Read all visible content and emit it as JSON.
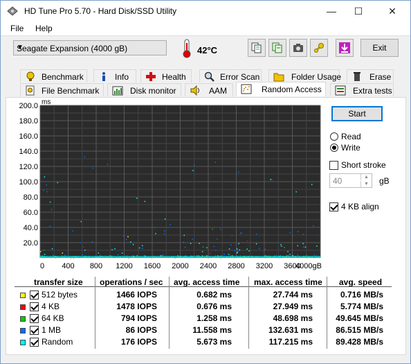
{
  "window": {
    "title": "HD Tune Pro 5.70 - Hard Disk/SSD Utility",
    "minimize": "—",
    "maximize": "☐",
    "close": "✕"
  },
  "menu": {
    "file": "File",
    "help": "Help"
  },
  "toolbar": {
    "drive": "Seagate Expansion (4000 gB)",
    "temperature": "42°C",
    "exit_label": "Exit"
  },
  "tabs_row1": [
    {
      "label": "Benchmark",
      "icon": "benchmark-icon"
    },
    {
      "label": "Info",
      "icon": "info-icon"
    },
    {
      "label": "Health",
      "icon": "health-icon"
    },
    {
      "label": "Error Scan",
      "icon": "error-scan-icon"
    },
    {
      "label": "Folder Usage",
      "icon": "folder-icon"
    },
    {
      "label": "Erase",
      "icon": "erase-icon"
    }
  ],
  "tabs_row2": [
    {
      "label": "File Benchmark",
      "icon": "file-benchmark-icon"
    },
    {
      "label": "Disk monitor",
      "icon": "disk-monitor-icon"
    },
    {
      "label": "AAM",
      "icon": "aam-icon"
    },
    {
      "label": "Random Access",
      "icon": "random-access-icon"
    },
    {
      "label": "Extra tests",
      "icon": "extra-tests-icon"
    }
  ],
  "controls": {
    "start_label": "Start",
    "read_label": "Read",
    "write_label": "Write",
    "mode": "write",
    "short_stroke_label": "Short stroke",
    "short_stroke_checked": false,
    "stroke_value": "40",
    "stroke_unit": "gB",
    "align_label": "4 KB align",
    "align_checked": true
  },
  "chart_data": {
    "type": "scatter",
    "ylabel": "ms",
    "xlabel": "",
    "ylim": [
      0,
      200
    ],
    "xlim": [
      0,
      4000
    ],
    "yticks": [
      "200.0",
      "180.0",
      "160.0",
      "140.0",
      "120.0",
      "100.0",
      "80.0",
      "60.0",
      "40.0",
      "20.0"
    ],
    "xticks": [
      "0",
      "400",
      "800",
      "1200",
      "1600",
      "2000",
      "2400",
      "2800",
      "3200",
      "3600",
      "4000gB"
    ],
    "grid": true,
    "background": "#2b2b2b",
    "series": [
      {
        "name": "512 bytes",
        "color": "#ffff00",
        "avg_ms": 0.682,
        "max_ms": 27.744
      },
      {
        "name": "4 KB",
        "color": "#ff0000",
        "avg_ms": 0.676,
        "max_ms": 27.949
      },
      {
        "name": "64 KB",
        "color": "#00cc00",
        "avg_ms": 1.258,
        "max_ms": 48.698
      },
      {
        "name": "1 MB",
        "color": "#0070ff",
        "avg_ms": 11.558,
        "max_ms": 132.631
      },
      {
        "name": "Random",
        "color": "#00ffff",
        "avg_ms": 5.673,
        "max_ms": 117.215
      }
    ]
  },
  "results": {
    "headers": [
      "transfer size",
      "operations / sec",
      "avg. access time",
      "max. access time",
      "avg. speed"
    ],
    "rows": [
      {
        "name": "512 bytes",
        "color": "#ffff00",
        "ops": "1466 IOPS",
        "avg": "0.682 ms",
        "max": "27.744 ms",
        "speed": "0.716 MB/s"
      },
      {
        "name": "4 KB",
        "color": "#ff0000",
        "ops": "1478 IOPS",
        "avg": "0.676 ms",
        "max": "27.949 ms",
        "speed": "5.774 MB/s"
      },
      {
        "name": "64 KB",
        "color": "#00cc00",
        "ops": "794 IOPS",
        "avg": "1.258 ms",
        "max": "48.698 ms",
        "speed": "49.645 MB/s"
      },
      {
        "name": "1 MB",
        "color": "#0070ff",
        "ops": "86 IOPS",
        "avg": "11.558 ms",
        "max": "132.631 ms",
        "speed": "86.515 MB/s"
      },
      {
        "name": "Random",
        "color": "#00ffff",
        "ops": "176 IOPS",
        "avg": "5.673 ms",
        "max": "117.215 ms",
        "speed": "89.428 MB/s"
      }
    ]
  }
}
